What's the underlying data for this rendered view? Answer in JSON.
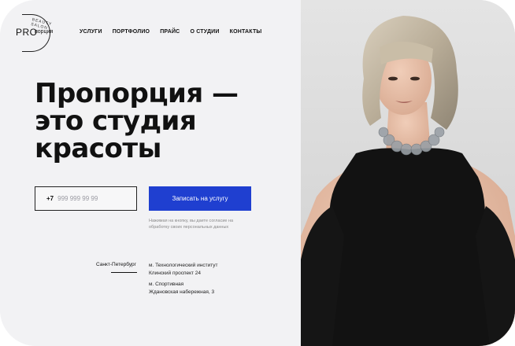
{
  "logo": {
    "mark": "PRO",
    "name": "порция",
    "tagline": "BEAUTY SALON"
  },
  "nav": {
    "items": [
      {
        "label": "УСЛУГИ"
      },
      {
        "label": "ПОРТФОЛИО"
      },
      {
        "label": "ПРАЙС"
      },
      {
        "label": "О СТУДИИ"
      },
      {
        "label": "КОНТАКТЫ"
      }
    ]
  },
  "hero": {
    "line1": "Пропорция —",
    "line2": "это студия",
    "line3": "красоты"
  },
  "form": {
    "phone_prefix": "+7",
    "phone_placeholder": "999 999 99 99",
    "cta_label": "Записать на услугу",
    "consent_line1": "Нажимая на кнопку, вы даете согласие на",
    "consent_line2": "обработку своих персональных данных"
  },
  "contacts": {
    "city": "Санкт-Петербург",
    "addresses": [
      {
        "metro": "м. Технологический институт",
        "street": "Клинский проспект 24"
      },
      {
        "metro": "м. Спортивная",
        "street": "Ждановская набережная, 3"
      }
    ]
  },
  "colors": {
    "accent": "#1f3fd0",
    "background": "#f2f2f4",
    "text": "#111111"
  }
}
